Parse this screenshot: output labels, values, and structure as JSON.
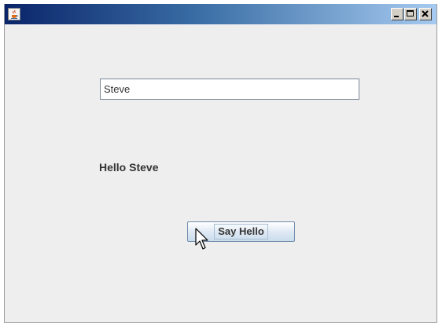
{
  "window": {
    "title": "",
    "app_icon": "java-coffee-cup-icon",
    "controls": [
      "minimize-icon",
      "maximize-icon",
      "close-icon"
    ],
    "titlebar_gradient": [
      "#0a246a",
      "#3a6ea5",
      "#a6caf0"
    ]
  },
  "form": {
    "name_input_value": "Steve",
    "greeting_text": "Hello Steve",
    "button_label": "Say Hello"
  },
  "cursor": {
    "icon": "mouse-pointer-arrow"
  },
  "colors": {
    "panel_bg": "#eeeeee",
    "text": "#333333",
    "button_border": "#6e8bab"
  }
}
